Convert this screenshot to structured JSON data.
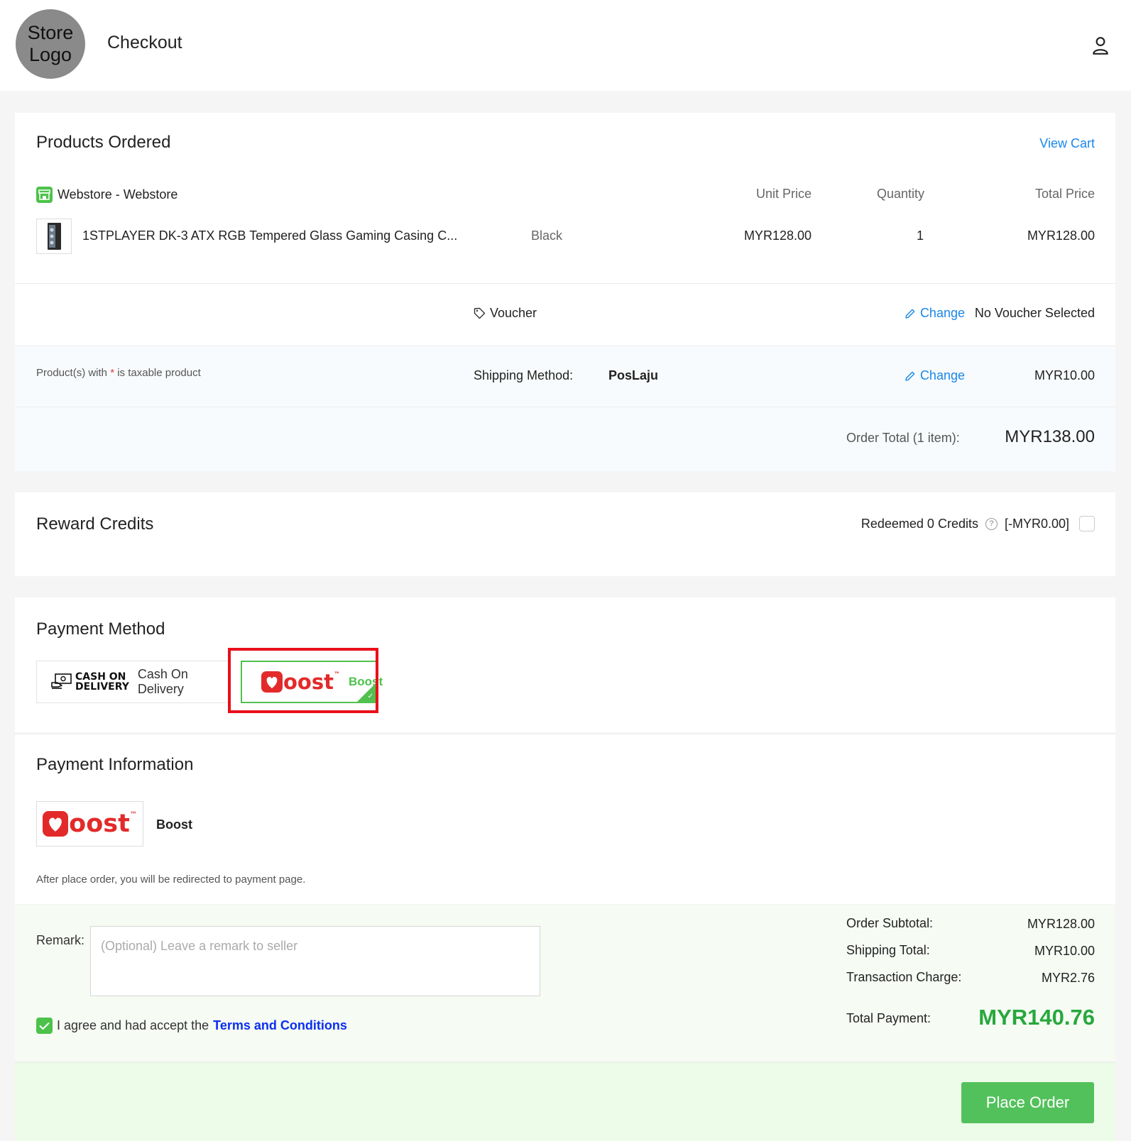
{
  "header": {
    "logo_text": "Store\nLogo",
    "title": "Checkout",
    "account_icon": "user-icon"
  },
  "products": {
    "title": "Products Ordered",
    "view_cart": "View Cart",
    "store_name": "Webstore - Webstore",
    "columns": {
      "unit_price": "Unit Price",
      "quantity": "Quantity",
      "total_price": "Total Price"
    },
    "items": [
      {
        "name": "1STPLAYER DK-3 ATX RGB Tempered Glass Gaming Casing C...",
        "variant": "Black",
        "unit_price": "MYR128.00",
        "quantity": "1",
        "total_price": "MYR128.00"
      }
    ],
    "voucher_label": "Voucher",
    "voucher_change": "Change",
    "voucher_status": "No Voucher Selected",
    "taxable_note_pre": "Product(s) with",
    "taxable_star": "*",
    "taxable_note_post": "is taxable product",
    "shipping_label": "Shipping Method:",
    "shipping_method": "PosLaju",
    "shipping_change": "Change",
    "shipping_price": "MYR10.00",
    "order_total_label": "Order Total (1 item):",
    "order_total": "MYR138.00"
  },
  "reward": {
    "title": "Reward Credits",
    "redeemed": "Redeemed 0 Credits",
    "amount": "[-MYR0.00]",
    "checked": false
  },
  "payment_method": {
    "title": "Payment Method",
    "options": [
      {
        "badge_line1": "CASH ON",
        "badge_line2": "DELIVERY",
        "label": "Cash On Delivery",
        "selected": false
      },
      {
        "brand": "oost",
        "brand_tm": "™",
        "label": "Boost",
        "selected": true
      }
    ]
  },
  "payment_info": {
    "title": "Payment Information",
    "brand": "oost",
    "brand_tm": "™",
    "name": "Boost",
    "note": "After place order, you will be redirected to payment page."
  },
  "summary": {
    "remark_label": "Remark:",
    "remark_placeholder": "(Optional) Leave a remark to seller",
    "agree_text": "I agree and had accept the",
    "terms_link": "Terms and Conditions",
    "agree_checked": true,
    "subtotal_label": "Order Subtotal:",
    "subtotal": "MYR128.00",
    "shipping_label": "Shipping Total:",
    "shipping": "MYR10.00",
    "transaction_label": "Transaction Charge:",
    "transaction": "MYR2.76",
    "total_label": "Total Payment:",
    "total": "MYR140.76"
  },
  "footer": {
    "place_order": "Place Order"
  },
  "colors": {
    "accent_green": "#4cc24a",
    "link_blue": "#1a87e8",
    "boost_red": "#e32a2a",
    "highlight_red": "#e8101a",
    "terms_blue": "#0a2ff0"
  }
}
